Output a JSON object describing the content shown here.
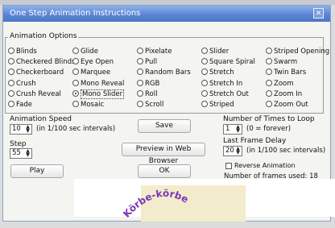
{
  "window": {
    "title": "One Step Animation Instructions",
    "close_glyph": "✕"
  },
  "group": {
    "label": "Animation Options",
    "columns": [
      [
        {
          "label": "Blinds"
        },
        {
          "label": "Checkered Blinds"
        },
        {
          "label": "Checkerboard"
        },
        {
          "label": "Crush"
        },
        {
          "label": "Crush Reveal"
        },
        {
          "label": "Fade"
        }
      ],
      [
        {
          "label": "Glide"
        },
        {
          "label": "Eye Open"
        },
        {
          "label": "Marquee"
        },
        {
          "label": "Mono Reveal"
        },
        {
          "label": "Mono Slider"
        },
        {
          "label": "Mosaic"
        }
      ],
      [
        {
          "label": "Pixelate"
        },
        {
          "label": "Pull"
        },
        {
          "label": "Random Bars"
        },
        {
          "label": "RGB"
        },
        {
          "label": "Roll"
        },
        {
          "label": "Scroll"
        }
      ],
      [
        {
          "label": "Slider"
        },
        {
          "label": "Square Spiral"
        },
        {
          "label": "Stretch"
        },
        {
          "label": "Stretch In"
        },
        {
          "label": "Stretch Out"
        },
        {
          "label": "Striped"
        }
      ],
      [
        {
          "label": "Striped Opening"
        },
        {
          "label": "Swarm"
        },
        {
          "label": "Twin Bars"
        },
        {
          "label": "Zoom"
        },
        {
          "label": "Zoom In"
        },
        {
          "label": "Zoom Out"
        }
      ]
    ],
    "selected": "Mono Slider"
  },
  "controls": {
    "speed_label": "Animation Speed",
    "speed_value": "10",
    "speed_unit": "(in 1/100 sec intervals)",
    "step_label": "Step",
    "step_value": "55",
    "save_label": "Save",
    "preview_label": "Preview in Web Browser",
    "play_label": "Play",
    "ok_label": "OK",
    "loop_label": "Number of Times to Loop",
    "loop_value": "1",
    "loop_note": "(0 = forever)",
    "delay_label": "Last Frame Delay",
    "delay_value": "20",
    "delay_unit": "(in 1/100 sec intervals)",
    "reverse_label": "Reverse Animation",
    "reverse_checked": false,
    "frames_label": "Number of frames used: 18"
  },
  "preview": {
    "arc_text": "Körbe-körbe"
  }
}
